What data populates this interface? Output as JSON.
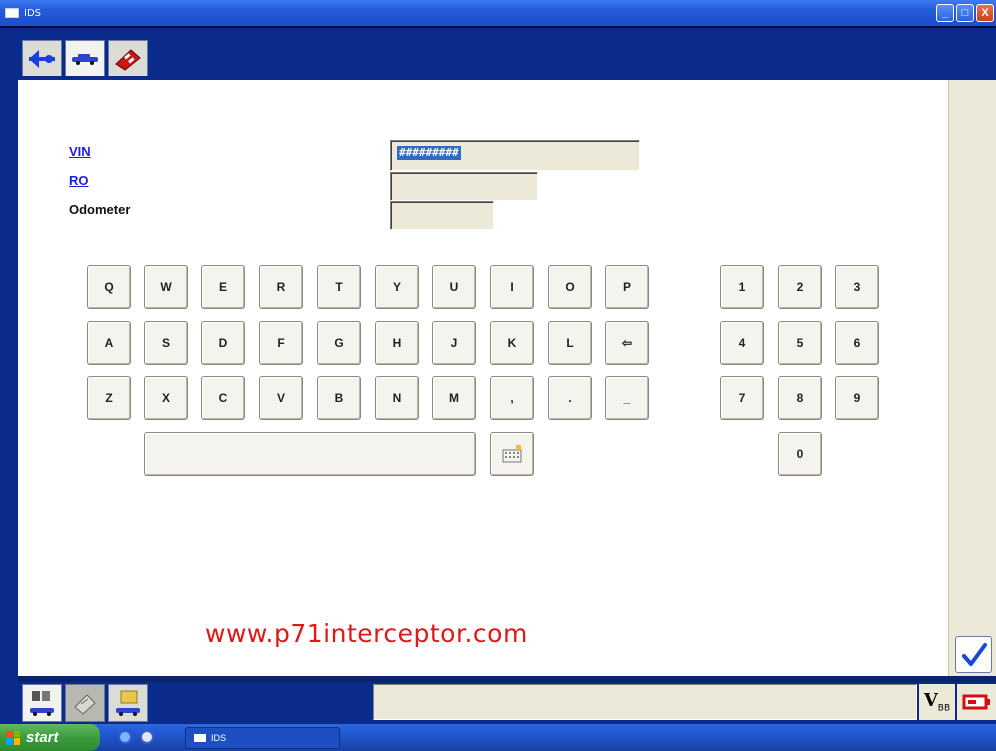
{
  "window": {
    "title": "IDS",
    "controls": {
      "minimize": "_",
      "maximize": "□",
      "close": "X"
    }
  },
  "top_tabs": [
    {
      "icon": "blue-arrow-icon"
    },
    {
      "icon": "car-icon"
    },
    {
      "icon": "toolbox-icon"
    }
  ],
  "form": {
    "vin": {
      "label": "VIN",
      "value": "#########"
    },
    "ro": {
      "label": "RO",
      "value": ""
    },
    "odometer": {
      "label": "Odometer",
      "value": ""
    }
  },
  "keyboard": {
    "row1": [
      "Q",
      "W",
      "E",
      "R",
      "T",
      "Y",
      "U",
      "I",
      "O",
      "P"
    ],
    "row2": [
      "A",
      "S",
      "D",
      "F",
      "G",
      "H",
      "J",
      "K",
      "L",
      "⇦"
    ],
    "row3": [
      "Z",
      "X",
      "C",
      "V",
      "B",
      "N",
      "M",
      ",",
      ".",
      "_"
    ],
    "numpad": [
      "1",
      "2",
      "3",
      "4",
      "5",
      "6",
      "7",
      "8",
      "9",
      "0"
    ]
  },
  "watermark": "www.p71interceptor.com",
  "bottom_tabs": [
    {
      "icon": "vehicle-data-icon"
    },
    {
      "icon": "toolbox-gray-icon"
    },
    {
      "icon": "folder-car-icon"
    }
  ],
  "status": {
    "field_text": "",
    "vbat_main": "V",
    "vbat_sub": "BB",
    "battery_icon": "battery-red-icon"
  },
  "taskbar": {
    "start_label": "start",
    "task_title": "IDS"
  },
  "colors": {
    "accent_blue": "#0a2a8c",
    "link_blue": "#2020e0",
    "watermark_red": "#e01818",
    "selection_blue": "#316ac5"
  }
}
